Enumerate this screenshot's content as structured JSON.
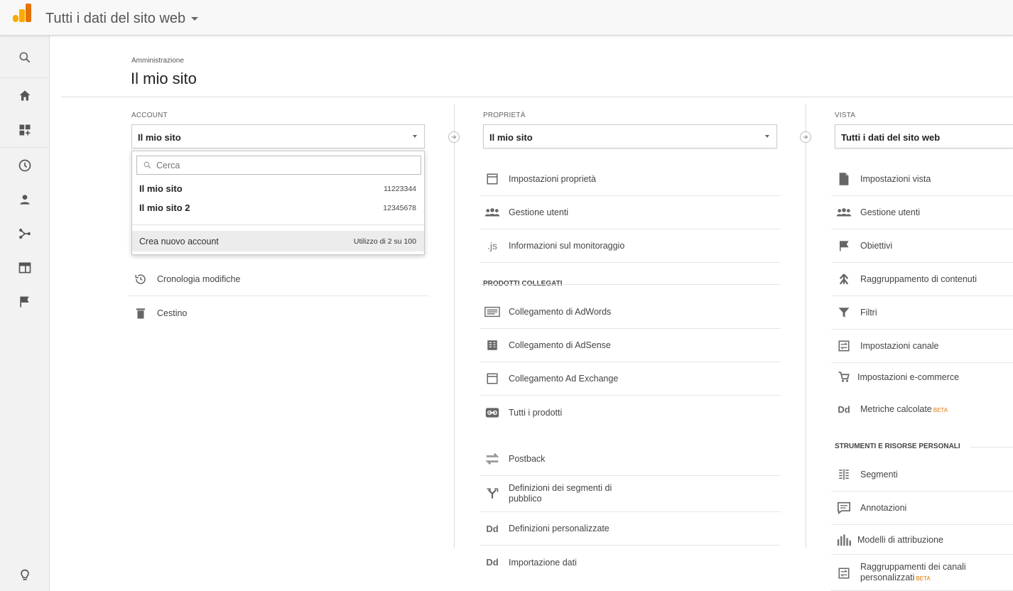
{
  "header": {
    "site_selector": "Tutti i dati del sito web"
  },
  "leftnav": [
    {
      "icon": "search-icon"
    },
    {
      "icon": "home-icon"
    },
    {
      "icon": "customization-icon"
    },
    {
      "icon": "clock-icon"
    },
    {
      "icon": "person-icon"
    },
    {
      "icon": "acquisition-icon"
    },
    {
      "icon": "behavior-icon"
    },
    {
      "icon": "flag-icon"
    },
    {
      "icon": "lightbulb-icon"
    }
  ],
  "page": {
    "breadcrumb": "Amministrazione",
    "title": "Il mio sito"
  },
  "account": {
    "label": "ACCOUNT",
    "selected": "Il mio sito",
    "dropdown": {
      "search_placeholder": "Cerca",
      "items": [
        {
          "name": "Il mio sito",
          "id": "11223344"
        },
        {
          "name": "Il mio sito 2",
          "id": "12345678"
        }
      ],
      "create_label": "Crea nuovo account",
      "usage": "Utilizzo di 2 su 100"
    },
    "menu": [
      {
        "label": "Cronologia modifiche",
        "icon": "history-icon"
      },
      {
        "label": "Cestino",
        "icon": "trash-icon"
      }
    ]
  },
  "property": {
    "label": "PROPRIETÀ",
    "selected": "Il mio sito",
    "menu": [
      {
        "label": "Impostazioni proprietà",
        "icon": "window-icon"
      },
      {
        "label": "Gestione utenti",
        "icon": "users-icon"
      },
      {
        "label": "Informazioni sul monitoraggio",
        "icon": "js-icon"
      }
    ],
    "linked_header": "PRODOTTI COLLEGATI",
    "linked": [
      {
        "label": "Collegamento di AdWords",
        "icon": "adwords-icon"
      },
      {
        "label": "Collegamento di AdSense",
        "icon": "adsense-icon"
      },
      {
        "label": "Collegamento Ad Exchange",
        "icon": "adexchange-icon"
      },
      {
        "label": "Tutti i prodotti",
        "icon": "link-icon"
      }
    ],
    "more": [
      {
        "label": "Postback",
        "icon": "postback-icon"
      },
      {
        "label": "Definizioni dei segmenti di pubblico",
        "icon": "fork-icon"
      },
      {
        "label": "Definizioni personalizzate",
        "icon": "dd-icon"
      },
      {
        "label": "Importazione dati",
        "icon": "dd-icon"
      }
    ],
    "js_glyph": ".js",
    "dd_glyph": "Dd"
  },
  "view": {
    "label": "VISTA",
    "selected": "Tutti i dati del sito web",
    "menu": [
      {
        "label": "Impostazioni vista",
        "icon": "document-icon"
      },
      {
        "label": "Gestione utenti",
        "icon": "users-icon"
      },
      {
        "label": "Obiettivi",
        "icon": "flag-icon"
      },
      {
        "label": "Raggruppamento di contenuti",
        "icon": "grouping-icon"
      },
      {
        "label": "Filtri",
        "icon": "filter-icon"
      },
      {
        "label": "Impostazioni canale",
        "icon": "channel-icon"
      },
      {
        "label": "Impostazioni e-commerce",
        "icon": "cart-icon"
      },
      {
        "label": "Metriche calcolate",
        "icon": "dd-icon",
        "badge": "BETA"
      }
    ],
    "tools_header": "STRUMENTI E RISORSE PERSONALI",
    "tools": [
      {
        "label": "Segmenti",
        "icon": "segments-icon"
      },
      {
        "label": "Annotazioni",
        "icon": "comment-icon"
      },
      {
        "label": "Modelli di attribuzione",
        "icon": "bars-icon"
      },
      {
        "label": "Raggruppamenti dei canali personalizzati",
        "icon": "channel-icon",
        "badge": "BETA"
      }
    ]
  }
}
